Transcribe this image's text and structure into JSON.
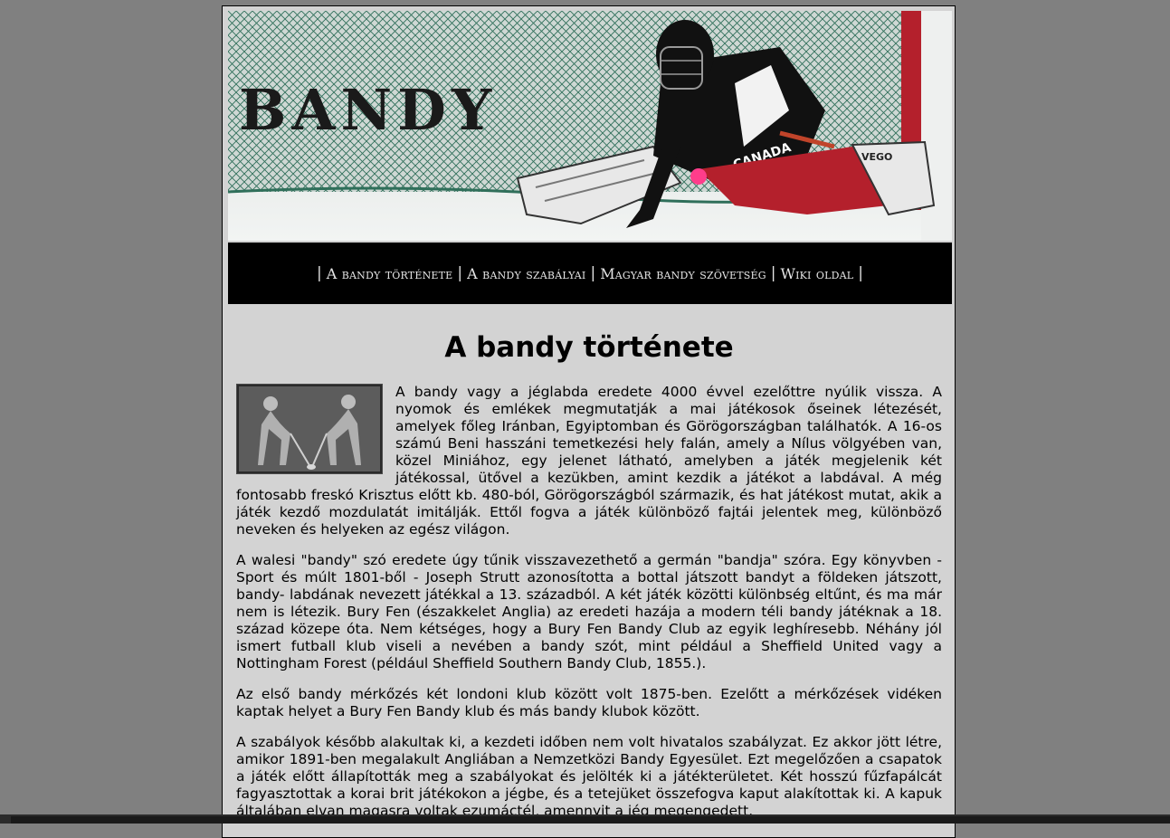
{
  "banner": {
    "title": "BANDY",
    "jersey_text": "CANADA",
    "pad_text": "VEGO",
    "colors": {
      "net_green": "#2f6f5a",
      "jersey_black": "#111111",
      "pants_red": "#b4202c",
      "ball_pink": "#ff3d8b",
      "ice": "#e9eceb"
    }
  },
  "nav": {
    "items": [
      {
        "label": "A bandy története"
      },
      {
        "label": "A bandy szabályai"
      },
      {
        "label": "Magyar bandy szövetség"
      },
      {
        "label": "Wiki oldal"
      }
    ],
    "separator": "|"
  },
  "main": {
    "title": "A bandy története",
    "paragraphs": [
      "A bandy vagy a jéglabda eredete 4000 évvel ezelőttre nyúlik vissza. A nyomok és emlékek megmutatják a mai játékosok őseinek létezését, amelyek főleg Iránban, Egyiptomban és Görögországban találhatók. A 16-os számú Beni hasszáni temetkezési hely falán, amely a Nílus völgyében van, közel Miniához, egy jelenet látható, amelyben a játék megjelenik két játékossal, ütővel a kezükben, amint kezdik a játékot a labdával. A még fontosabb freskó Krisztus előtt kb. 480-ból, Görögországból származik, és hat játékost mutat, akik a játék kezdő mozdulatát imitálják. Ettől fogva a játék különböző fajtái jelentek meg, különböző neveken és helyeken az egész világon.",
      "A walesi \"bandy\" szó eredete úgy tűnik visszavezethető a germán \"bandja\" szóra. Egy könyvben - Sport és múlt 1801-ből - Joseph Strutt azonosította a bottal játszott bandyt a földeken játszott, bandy- labdának nevezett játékkal a 13. századból. A két játék közötti különbség eltűnt, és ma már nem is létezik. Bury Fen (északkelet Anglia) az eredeti hazája a modern téli bandy játéknak a 18. század közepe óta. Nem kétséges, hogy a Bury Fen Bandy Club az egyik leghíresebb. Néhány jól ismert futball klub viseli a nevében a bandy szót, mint például a Sheffield United vagy a Nottingham Forest (például Sheffield Southern Bandy Club, 1855.).",
      "Az első bandy mérkőzés két londoni klub között volt 1875-ben. Ezelőtt a mérkőzések vidéken kaptak helyet a Bury Fen Bandy klub és más bandy klubok között.",
      "A szabályok később alakultak ki, a kezdeti időben nem volt hivatalos szabályzat. Ez akkor jött létre, amikor 1891-ben megalakult Angliában a Nemzetközi Bandy Egyesület. Ezt megelőzően a csapatok a játék előtt állapították meg a szabályokat és jelölték ki a játékterületet. Két hosszú fűzfapálcát fagyasztottak a korai brit játékokon a jégbe, és a tetejüket összefogva kaput alakítottak ki. A kapuk általában elvan magasra voltak ezumáctél, amennyit a jég megengedett."
    ]
  }
}
